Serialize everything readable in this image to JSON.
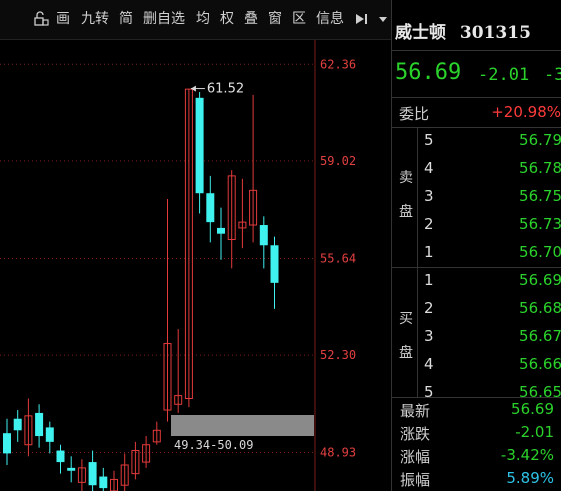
{
  "toolbar": {
    "items": [
      "画",
      "九转",
      "简",
      "删自选",
      "均",
      "权",
      "叠",
      "窗",
      "区",
      "信息"
    ]
  },
  "quote": {
    "name": "威士顿",
    "code": "301315",
    "price": "56.69",
    "change": "-2.01",
    "change_pct_partial": "-3",
    "webi_label": "委比",
    "webi_value": "+20.98%",
    "sell_label": [
      "卖",
      "盘"
    ],
    "buy_label": [
      "买",
      "盘"
    ],
    "sell": [
      {
        "level": "5",
        "price": "56.79"
      },
      {
        "level": "4",
        "price": "56.78"
      },
      {
        "level": "3",
        "price": "56.75"
      },
      {
        "level": "2",
        "price": "56.73"
      },
      {
        "level": "1",
        "price": "56.70"
      }
    ],
    "buy": [
      {
        "level": "1",
        "price": "56.69"
      },
      {
        "level": "2",
        "price": "56.68"
      },
      {
        "level": "3",
        "price": "56.67"
      },
      {
        "level": "4",
        "price": "56.66"
      },
      {
        "level": "5",
        "price": "56.65"
      }
    ],
    "stats": [
      {
        "label": "最新",
        "value": "56.69",
        "color": "#2bd22b"
      },
      {
        "label": "涨跌",
        "value": "-2.01",
        "color": "#2bd22b"
      },
      {
        "label": "涨幅",
        "value": "-3.42%",
        "color": "#2bd22b"
      },
      {
        "label": "振幅",
        "value": "5.89%",
        "color": "#2ec3e6"
      }
    ]
  },
  "colors": {
    "up": "#e33b3b",
    "down": "#3ff1ef",
    "price_green": "#2bd22b",
    "axis_text": "#e34040"
  },
  "chart_data": {
    "type": "candlestick",
    "y_ticks": [
      62.36,
      59.02,
      55.64,
      52.3,
      48.93
    ],
    "ylim": [
      47.6,
      63.2
    ],
    "high_marker": "61.52",
    "range_label": "49.34-50.09",
    "candles": [
      {
        "o": 49.6,
        "c": 48.9,
        "h": 50.1,
        "l": 48.5
      },
      {
        "o": 50.1,
        "c": 49.7,
        "h": 50.4,
        "l": 49.3
      },
      {
        "o": 49.2,
        "c": 50.2,
        "h": 50.8,
        "l": 48.8
      },
      {
        "o": 50.3,
        "c": 49.5,
        "h": 50.6,
        "l": 49.1
      },
      {
        "o": 49.8,
        "c": 49.3,
        "h": 50.0,
        "l": 48.9
      },
      {
        "o": 49.0,
        "c": 48.6,
        "h": 49.2,
        "l": 48.2
      },
      {
        "o": 48.4,
        "c": 48.3,
        "h": 48.8,
        "l": 47.9
      },
      {
        "o": 47.9,
        "c": 48.4,
        "h": 48.7,
        "l": 47.6
      },
      {
        "o": 48.6,
        "c": 47.8,
        "h": 49.0,
        "l": 47.6
      },
      {
        "o": 48.1,
        "c": 47.7,
        "h": 48.4,
        "l": 47.5
      },
      {
        "o": 47.6,
        "c": 48.0,
        "h": 48.3,
        "l": 47.4
      },
      {
        "o": 47.8,
        "c": 48.5,
        "h": 48.9,
        "l": 47.6
      },
      {
        "o": 48.2,
        "c": 49.0,
        "h": 49.3,
        "l": 48.0
      },
      {
        "o": 48.6,
        "c": 49.2,
        "h": 49.5,
        "l": 48.4
      },
      {
        "o": 49.3,
        "c": 49.7,
        "h": 50.0,
        "l": 49.2
      },
      {
        "o": 50.4,
        "c": 52.7,
        "h": 57.7,
        "l": 50.0
      },
      {
        "o": 50.6,
        "c": 50.9,
        "h": 53.2,
        "l": 50.3
      },
      {
        "o": 50.8,
        "c": 61.5,
        "h": 61.52,
        "l": 50.5
      },
      {
        "o": 61.2,
        "c": 57.9,
        "h": 61.4,
        "l": 57.2
      },
      {
        "o": 57.9,
        "c": 56.9,
        "h": 58.5,
        "l": 56.2
      },
      {
        "o": 56.7,
        "c": 56.5,
        "h": 57.4,
        "l": 55.6
      },
      {
        "o": 56.3,
        "c": 58.5,
        "h": 58.7,
        "l": 55.3
      },
      {
        "o": 56.7,
        "c": 56.9,
        "h": 58.4,
        "l": 56.0
      },
      {
        "o": 56.8,
        "c": 58.0,
        "h": 61.3,
        "l": 56.2
      },
      {
        "o": 56.8,
        "c": 56.1,
        "h": 57.1,
        "l": 55.3
      },
      {
        "o": 56.1,
        "c": 54.8,
        "h": 56.4,
        "l": 53.9
      }
    ]
  }
}
